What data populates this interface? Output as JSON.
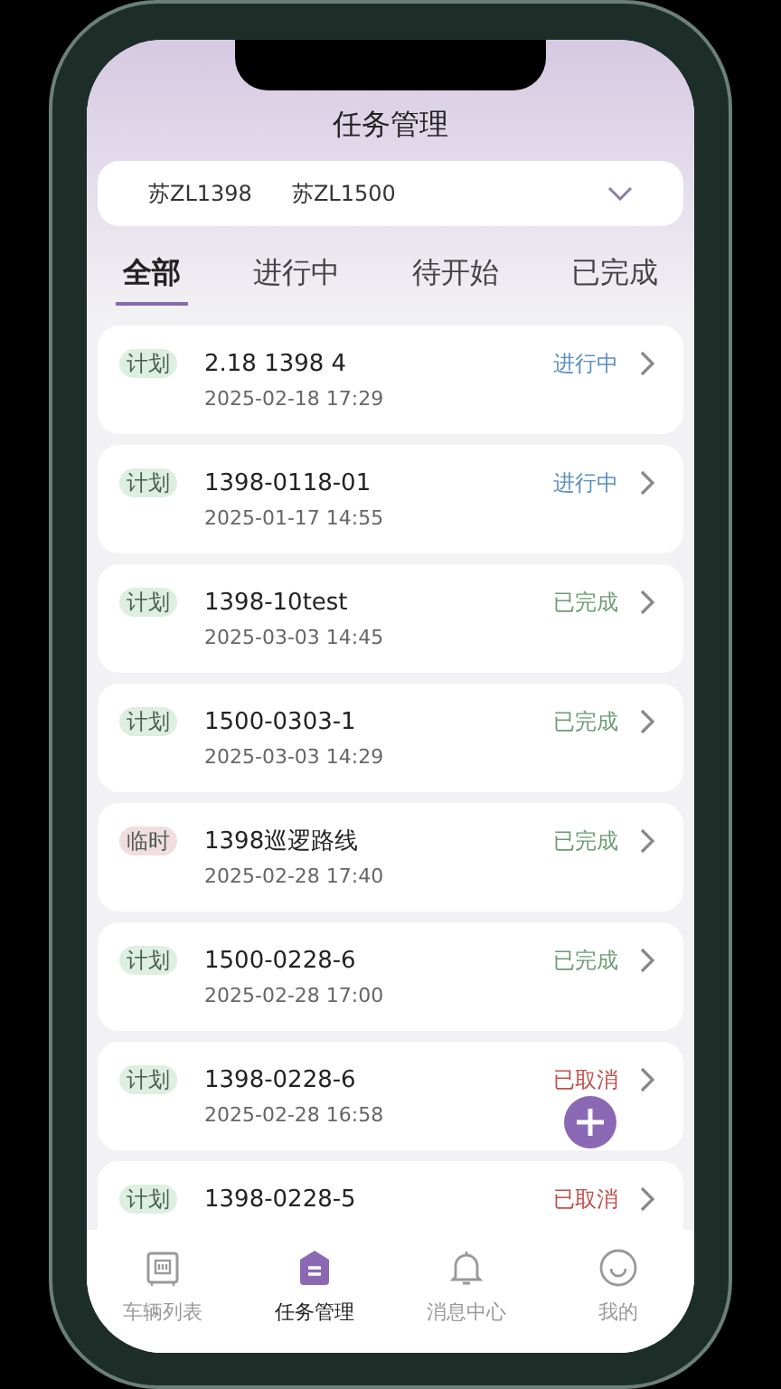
{
  "header": {
    "title": "任务管理"
  },
  "vehicle_selector": {
    "vehicles": [
      "苏ZL1398",
      "苏ZL1500"
    ]
  },
  "tabs": [
    {
      "label": "全部",
      "selected": true
    },
    {
      "label": "进行中",
      "selected": false
    },
    {
      "label": "待开始",
      "selected": false
    },
    {
      "label": "已完成",
      "selected": false
    }
  ],
  "tasks": [
    {
      "tag": {
        "text": "计划",
        "color": "#dcefe0"
      },
      "name": "2.18 1398 4",
      "time": "2025-02-18 17:29",
      "status": {
        "text": "进行中",
        "color": "#5a90c0"
      }
    },
    {
      "tag": {
        "text": "计划",
        "color": "#dcefe0"
      },
      "name": "1398-0118-01",
      "time": "2025-01-17 14:55",
      "status": {
        "text": "进行中",
        "color": "#5a90c0"
      }
    },
    {
      "tag": {
        "text": "计划",
        "color": "#dcefe0"
      },
      "name": "1398-10test",
      "time": "2025-03-03 14:45",
      "status": {
        "text": "已完成",
        "color": "#6c9c74"
      }
    },
    {
      "tag": {
        "text": "计划",
        "color": "#dcefe0"
      },
      "name": "1500-0303-1",
      "time": "2025-03-03 14:29",
      "status": {
        "text": "已完成",
        "color": "#6c9c74"
      }
    },
    {
      "tag": {
        "text": "临时",
        "color": "#f1dde1"
      },
      "name": "1398巡逻路线",
      "time": "2025-02-28 17:40",
      "status": {
        "text": "已完成",
        "color": "#6c9c74"
      }
    },
    {
      "tag": {
        "text": "计划",
        "color": "#dcefe0"
      },
      "name": "1500-0228-6",
      "time": "2025-02-28 17:00",
      "status": {
        "text": "已完成",
        "color": "#6c9c74"
      }
    },
    {
      "tag": {
        "text": "计划",
        "color": "#dcefe0"
      },
      "name": "1398-0228-6",
      "time": "2025-02-28 16:58",
      "status": {
        "text": "已取消",
        "color": "#c0504d"
      }
    },
    {
      "tag": {
        "text": "计划",
        "color": "#dcefe0"
      },
      "name": "1398-0228-5",
      "status": {
        "text": "已取消",
        "color": "#c0504d"
      }
    }
  ],
  "bottom_nav": [
    {
      "label": "车辆列表",
      "selected": false
    },
    {
      "label": "任务管理",
      "selected": true
    },
    {
      "label": "消息中心",
      "selected": false
    },
    {
      "label": "我的",
      "selected": false
    }
  ]
}
